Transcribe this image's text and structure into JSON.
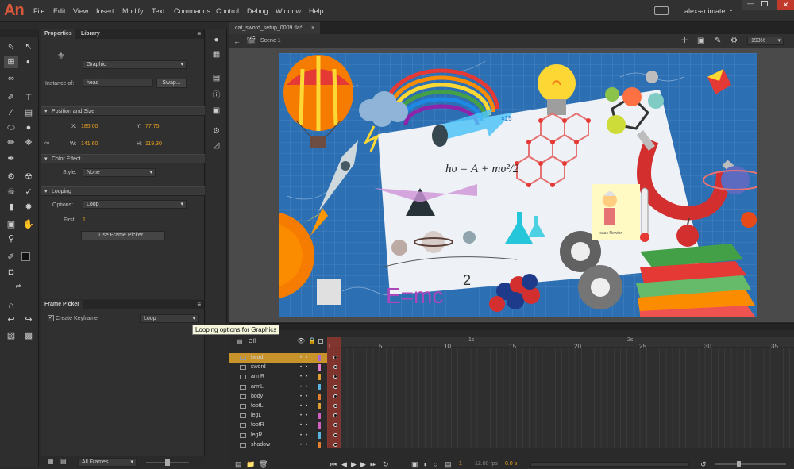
{
  "app": {
    "logo": "An",
    "menus": [
      "File",
      "Edit",
      "View",
      "Insert",
      "Modify",
      "Text",
      "Commands",
      "Control",
      "Debug",
      "Window",
      "Help"
    ],
    "user": "alex-animate",
    "user_chevron": "⌄"
  },
  "properties": {
    "tabs": [
      "Properties",
      "Library"
    ],
    "symbol_type": "Graphic",
    "instance_of_label": "Instance of:",
    "instance_of_value": "head",
    "swap_label": "Swap...",
    "sections": {
      "position_size": "Position and Size",
      "color_effect": "Color Effect",
      "looping": "Looping"
    },
    "x_label": "X:",
    "x_value": "185.00",
    "y_label": "Y:",
    "y_value": "77.75",
    "w_label": "W:",
    "w_value": "141.60",
    "h_label": "H:",
    "h_value": "119.30",
    "style_label": "Style:",
    "style_value": "None",
    "options_label": "Options:",
    "options_value": "Loop",
    "first_label": "First:",
    "first_value": "1",
    "frame_picker_button": "Use Frame Picker..."
  },
  "frame_picker": {
    "title": "Frame Picker",
    "create_keyframe_label": "Create Keyframe",
    "create_keyframe_checked": true,
    "loop_value": "Loop",
    "all_frames_value": "All Frames"
  },
  "tooltip": "Looping options for Graphics",
  "document": {
    "tab_name": "cat_sword_setup_0009.fla*",
    "close_glyph": "×",
    "scene": "Scene 1",
    "zoom": "193%"
  },
  "timeline": {
    "frame_numbers": [
      "1",
      "5",
      "10",
      "15",
      "20",
      "25",
      "30",
      "35"
    ],
    "second_markers": [
      "1s",
      "2s"
    ],
    "header_label": "Off",
    "layers": [
      {
        "name": "head",
        "color": "#a86ad6",
        "active": true
      },
      {
        "name": "sword",
        "color": "#e07fd0",
        "active": false
      },
      {
        "name": "armR",
        "color": "#e0a030",
        "active": false
      },
      {
        "name": "armL",
        "color": "#5bb3e0",
        "active": false
      },
      {
        "name": "body",
        "color": "#e08030",
        "active": false
      },
      {
        "name": "footL",
        "color": "#e0a030",
        "active": false
      },
      {
        "name": "legL",
        "color": "#d060c0",
        "active": false
      },
      {
        "name": "footR",
        "color": "#d060c0",
        "active": false
      },
      {
        "name": "legR",
        "color": "#5bb3e0",
        "active": false
      },
      {
        "name": "shadow",
        "color": "#e08030",
        "active": false
      }
    ],
    "footer_frame": "1",
    "footer_fps": "12.00 fps",
    "footer_time": "0.0 s"
  },
  "stage_text": {
    "formula": "hυ = A + mυ²/2",
    "emc": "E=mc",
    "emc_exp": "2",
    "x15": "×15",
    "sticky_name": "Isaac Newton"
  },
  "colors": {
    "accent": "#e7a21f",
    "logo": "#d9573a",
    "playhead": "#c0392b",
    "stage_bg": "#2d6fb3"
  }
}
